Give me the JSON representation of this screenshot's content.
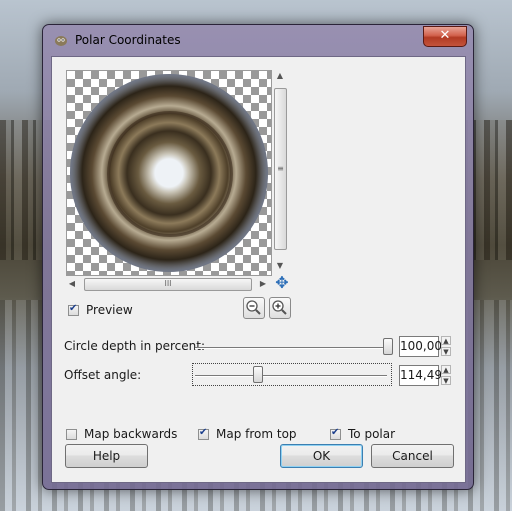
{
  "window": {
    "title": "Polar Coordinates",
    "close_glyph": "✕"
  },
  "preview": {
    "checkbox_label": "Preview",
    "checked": true,
    "vscroll_grip": "≡",
    "hscroll_grip": "III",
    "up_arrow": "▲",
    "down_arrow": "▼",
    "left_arrow": "◀",
    "right_arrow": "▶",
    "navigate_glyph": "✥"
  },
  "settings": {
    "circle_depth": {
      "label": "Circle depth in percent:",
      "value": "100,00",
      "level": 1.0
    },
    "offset_angle": {
      "label": "Offset angle:",
      "value": "114,49",
      "level": 0.318
    }
  },
  "options": [
    {
      "label": "Map backwards",
      "checked": false
    },
    {
      "label": "Map from top",
      "checked": true
    },
    {
      "label": "To polar",
      "checked": true
    }
  ],
  "buttons": {
    "help": "Help",
    "ok": "OK",
    "cancel": "Cancel"
  },
  "spin": {
    "up": "▲",
    "down": "▼"
  }
}
